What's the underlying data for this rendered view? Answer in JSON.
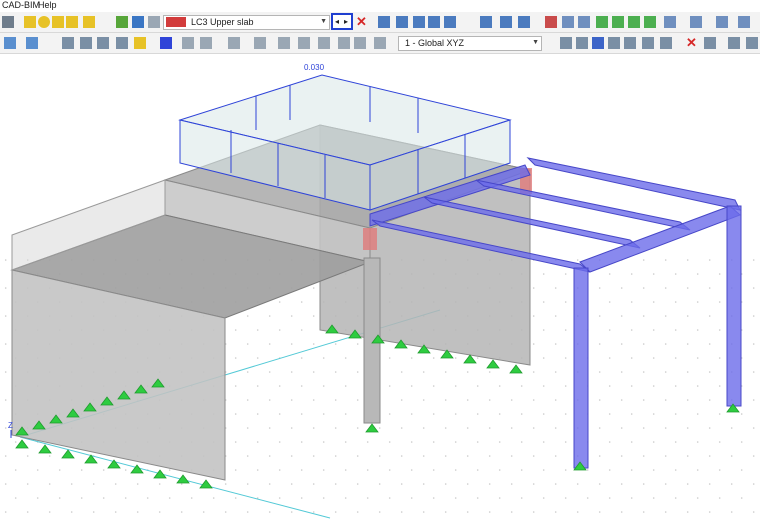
{
  "menu": {
    "items": [
      "CAD-BIM",
      "Help"
    ]
  },
  "toolbar": {
    "load_case": {
      "code": "LC3",
      "name": "Upper slab",
      "color": "#d23c3c"
    },
    "nav": {
      "prev": "◂",
      "next": "▸"
    },
    "coordinate_system": "1 - Global XYZ"
  },
  "viewport": {
    "load_value": "0.030",
    "axis_label": "Z",
    "colors": {
      "member": "#6b6bea",
      "support": "#2ecc40",
      "load": "#2f44d8",
      "wall": "#a9a9a9"
    }
  }
}
